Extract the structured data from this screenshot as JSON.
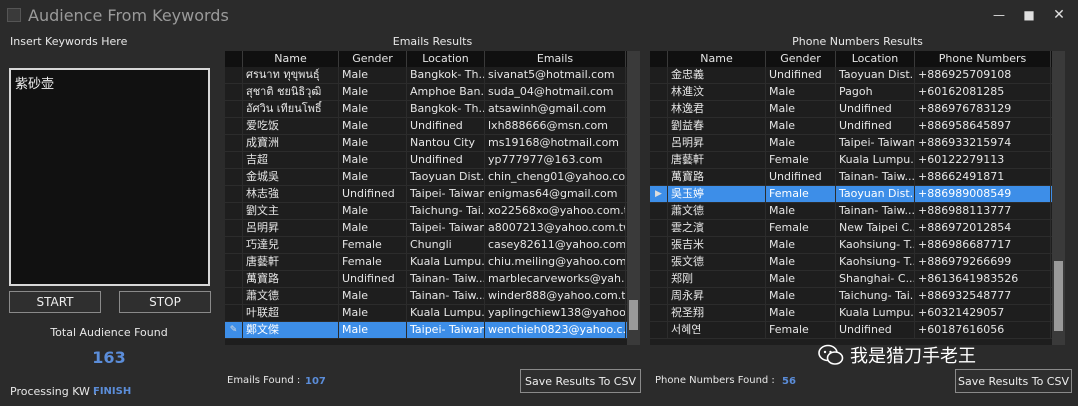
{
  "window": {
    "title": "Audience From Keywords",
    "icon": "app-icon",
    "controls": [
      "minimize-icon",
      "maximize-icon",
      "close-icon"
    ]
  },
  "left": {
    "keywords_label": "Insert Keywords Here",
    "keywords_value": "紫砂壶",
    "start_label": "START",
    "stop_label": "STOP",
    "total_label": "Total Audience Found",
    "total_value": "163",
    "processing_label": "Processing KW :",
    "processing_value": "FINISH"
  },
  "emails": {
    "title": "Emails Results",
    "columns": [
      "Name",
      "Gender",
      "Location",
      "Emails"
    ],
    "rows": [
      [
        "ศรนาท ทุขุพนธุ์",
        "Male",
        "Bangkok- Th...",
        "sivanat5@hotmail.com"
      ],
      [
        "สุชาติ ชยนิธิวุฒิ",
        "Male",
        "Amphoe Ban...",
        "suda_04@hotmail.com"
      ],
      [
        "อัศวิน เทียนโพธิ์",
        "Male",
        "Bangkok- Th...",
        "atsawinh@gmail.com"
      ],
      [
        "爱吃饭",
        "Male",
        "Undifined",
        "lxh888666@msn.com"
      ],
      [
        "成寶洲",
        "Male",
        "Nantou City",
        "ms19168@hotmail.com"
      ],
      [
        "吉超",
        "Male",
        "Undifined",
        "yp777977@163.com"
      ],
      [
        "金城吳",
        "Male",
        "Taoyuan Dist...",
        "chin_cheng01@yahoo.co..."
      ],
      [
        "林志強",
        "Undifined",
        "Taipei- Taiwan",
        "enigmas64@gmail.com"
      ],
      [
        "劉文主",
        "Male",
        "Taichung- Tai...",
        "xo22568xo@yahoo.com.tw"
      ],
      [
        "呂明昇",
        "Male",
        "Taipei- Taiwan",
        "a8007213@yahoo.com.tw"
      ],
      [
        "巧達兒",
        "Female",
        "Chungli",
        "casey82611@yahoo.com..."
      ],
      [
        "唐藝軒",
        "Female",
        "Kuala Lumpu...",
        "chiu.meiling@yahoo.com..."
      ],
      [
        "萬寶路",
        "Undifined",
        "Tainan- Taiw...",
        "marblecarveworks@yah..."
      ],
      [
        "蕭文德",
        "Male",
        "Tainan- Taiw...",
        "winder888@yahoo.com.tw"
      ],
      [
        "叶联超",
        "Male",
        "Kuala Lumpu...",
        "yaplingchiew138@yahoo..."
      ],
      [
        "鄭文傑",
        "Male",
        "Taipei- Taiwan",
        "wenchieh0823@yahoo.c..."
      ]
    ],
    "selected_index": 15,
    "found_label": "Emails Found :",
    "found_value": "107",
    "save_label": "Save Results To CSV"
  },
  "phones": {
    "title": "Phone Numbers Results",
    "columns": [
      "Name",
      "Gender",
      "Location",
      "Phone Numbers"
    ],
    "rows": [
      [
        "金忠義",
        "Undifined",
        "Taoyuan Dist...",
        "+886925709108"
      ],
      [
        "林進汶",
        "Male",
        "Pagoh",
        "+60162081285"
      ],
      [
        "林逸君",
        "Male",
        "Undifined",
        "+886976783129"
      ],
      [
        "劉益春",
        "Male",
        "Undifined",
        "+886958645897"
      ],
      [
        "呂明昇",
        "Male",
        "Taipei- Taiwan",
        "+886933215974"
      ],
      [
        "唐藝軒",
        "Female",
        "Kuala Lumpu...",
        "+60122279113"
      ],
      [
        "萬寶路",
        "Undifined",
        "Tainan- Taiw...",
        "+88662491871"
      ],
      [
        "吳玉婷",
        "Female",
        "Taoyuan Dist...",
        "+886989008549"
      ],
      [
        "蕭文德",
        "Male",
        "Tainan- Taiw...",
        "+886988113777"
      ],
      [
        "雲之濱",
        "Female",
        "New Taipei C...",
        "+886972012854"
      ],
      [
        "張吉米",
        "Male",
        "Kaohsiung- T...",
        "+886986687717"
      ],
      [
        "張文德",
        "Male",
        "Kaohsiung- T...",
        "+886979266699"
      ],
      [
        "郑刚",
        "Male",
        "Shanghai- C...",
        "+8613641983526"
      ],
      [
        "周永昇",
        "Male",
        "Taichung- Tai...",
        "+886932548777"
      ],
      [
        "祝圣翔",
        "Male",
        "Kuala Lumpu...",
        "+60321429057"
      ],
      [
        "서혜연",
        "Female",
        "Undifined",
        "+60187616056"
      ]
    ],
    "selected_index": 7,
    "found_label": "Phone Numbers Found :",
    "found_value": "56",
    "save_label": "Save Results To CSV"
  },
  "watermark": {
    "text": "我是猎刀手老王",
    "icon": "wechat-icon"
  },
  "colors": {
    "accent": "#3d8ee8",
    "count": "#5b8dd9",
    "background": "#2b2b2b"
  }
}
